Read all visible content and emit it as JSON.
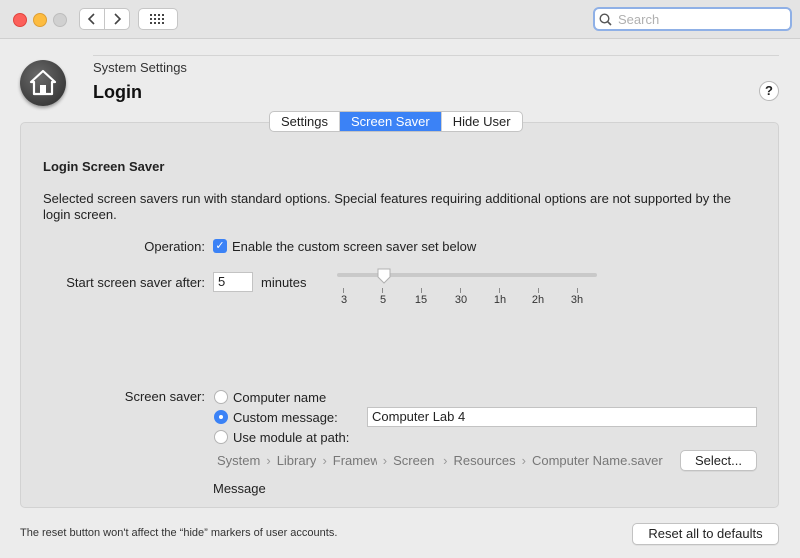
{
  "toolbar": {
    "search_placeholder": "Search",
    "back_icon": "chevron-left-icon",
    "forward_icon": "chevron-right-icon",
    "grid_icon": "grid-icon"
  },
  "header": {
    "breadcrumb": "System Settings",
    "title": "Login",
    "help_label": "?"
  },
  "tabs": [
    {
      "label": "Settings",
      "active": false
    },
    {
      "label": "Screen Saver",
      "active": true
    },
    {
      "label": "Hide User",
      "active": false
    }
  ],
  "section": {
    "title": "Login Screen Saver",
    "description": "Selected screen savers run with standard options. Special features requiring additional options are not supported by the login screen."
  },
  "operation": {
    "label": "Operation:",
    "checkbox_label": "Enable the custom screen saver set below",
    "checked": true
  },
  "start_after": {
    "label": "Start screen saver after:",
    "value": "5",
    "unit": "minutes",
    "slider_ticks": [
      "3",
      "5",
      "15",
      "30",
      "1h",
      "2h",
      "3h"
    ],
    "slider_selected": "5"
  },
  "screen_saver": {
    "label": "Screen saver:",
    "options": [
      {
        "label": "Computer name",
        "selected": false
      },
      {
        "label": "Custom message:",
        "selected": true
      },
      {
        "label": "Use module at path:",
        "selected": false
      }
    ],
    "custom_message": "Computer Lab 4",
    "path_segments": [
      "System",
      "Library",
      "Framew",
      "Screen",
      "Resources",
      "Computer Name.saver"
    ],
    "select_button": "Select...",
    "message_label": "Message"
  },
  "footer": {
    "note": "The reset button won't affect the “hide” markers of user accounts.",
    "reset_button": "Reset all to defaults"
  },
  "colors": {
    "accent": "#3b82f6",
    "close": "#fc605b",
    "minimize": "#fdbc40"
  }
}
